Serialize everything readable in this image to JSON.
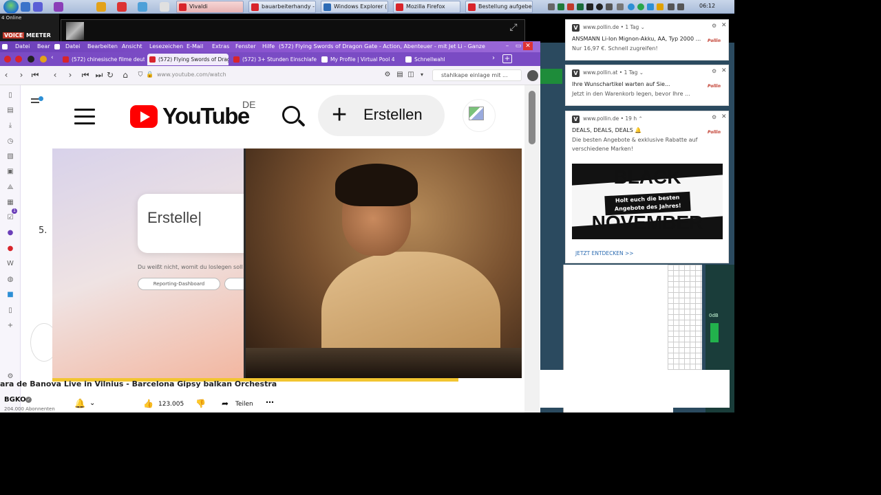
{
  "taskbar": {
    "tasks": [
      {
        "label": "Vivaldi",
        "color": "#d8242b"
      },
      {
        "label": "bauarbeiterhandy - ...",
        "color": "#d8242b"
      },
      {
        "label": "Windows Explorer (...",
        "color": "#2d6bb5"
      },
      {
        "label": "Mozilla Firefox",
        "color": "#d8242b"
      },
      {
        "label": "Bestellung aufgebe...",
        "color": "#d8242b"
      }
    ],
    "clock": "06:12"
  },
  "voicemeeter": {
    "status": "4 Online",
    "logo_a": "VOICE",
    "logo_b": "MEETER"
  },
  "browser": {
    "menu": [
      "Datei",
      "Bear",
      "Datei",
      "Bearbeiten",
      "Ansicht",
      "Lesezeichen",
      "E-Mail",
      "Extras",
      "Fenster",
      "Hilfe"
    ],
    "window_title": "(572) Flying Swords of Dragon Gate - Action, Abenteuer - mit Jet Li - Ganzen Fil...",
    "tabs": [
      {
        "label": "(572) chinesische filme deut",
        "color": "#d8242b"
      },
      {
        "label": "(572) Flying Swords of Drago",
        "color": "#d8242b"
      },
      {
        "label": "(572) 3+ Stunden Einschlafe",
        "color": "#d8242b"
      },
      {
        "label": "My Profile | Virtual Pool 4",
        "color": "#ffffff"
      },
      {
        "label": "Schnellwahl",
        "color": "#ffffff"
      }
    ],
    "url": "www.youtube.com/watch",
    "search_value": "stahlkape einlage mit ...",
    "sidepanel_badge": "1"
  },
  "youtube": {
    "wordmark": "YouTube",
    "country": "DE",
    "create_label": "Erstellen",
    "chapter_number": "5.",
    "hero": {
      "card_text": "Erstelle|",
      "hint": "Du weißt nicht, womit du loslegen soll",
      "chip": "Reporting-Dashboard"
    },
    "video_title": "ara de Banova Live in Vilnius - Barcelona Gipsy balkan Orchestra",
    "channel": "BGKO",
    "subscribers": "204.000 Abonnenten",
    "likes": "123.005",
    "share_label": "Teilen"
  },
  "notifications": [
    {
      "source": "www.pollin.de • 1 Tag ⌄",
      "line1": "ANSMANN Li-Ion Mignon-Akku, AA, Typ 2000 ...",
      "line2": "Nur 16,97 €. Schnell zugreifen!",
      "logo": "Pollin"
    },
    {
      "source": "www.pollin.at • 1 Tag ⌄",
      "line1": "Ihre Wunschartikel warten auf Sie...",
      "line2": "Jetzt in den Warenkorb legen, bevor Ihre ...",
      "logo": "Pollin"
    },
    {
      "source": "www.pollin.de • 19 h ⌃",
      "line1": "DEALS, DEALS, DEALS 🔔",
      "line2": "Die besten Angebote & exklusive Rabatte auf",
      "line3": "verschiedene Marken!",
      "logo": "Pollin",
      "banner_top": "BLACK",
      "banner_tag": "Holt euch die besten Angebote des Jahres!",
      "banner_bottom": "NOVEMBER",
      "cta": "JETZT ENTDECKEN >>"
    }
  ],
  "desktop": {
    "mixer_label": "0dB"
  }
}
